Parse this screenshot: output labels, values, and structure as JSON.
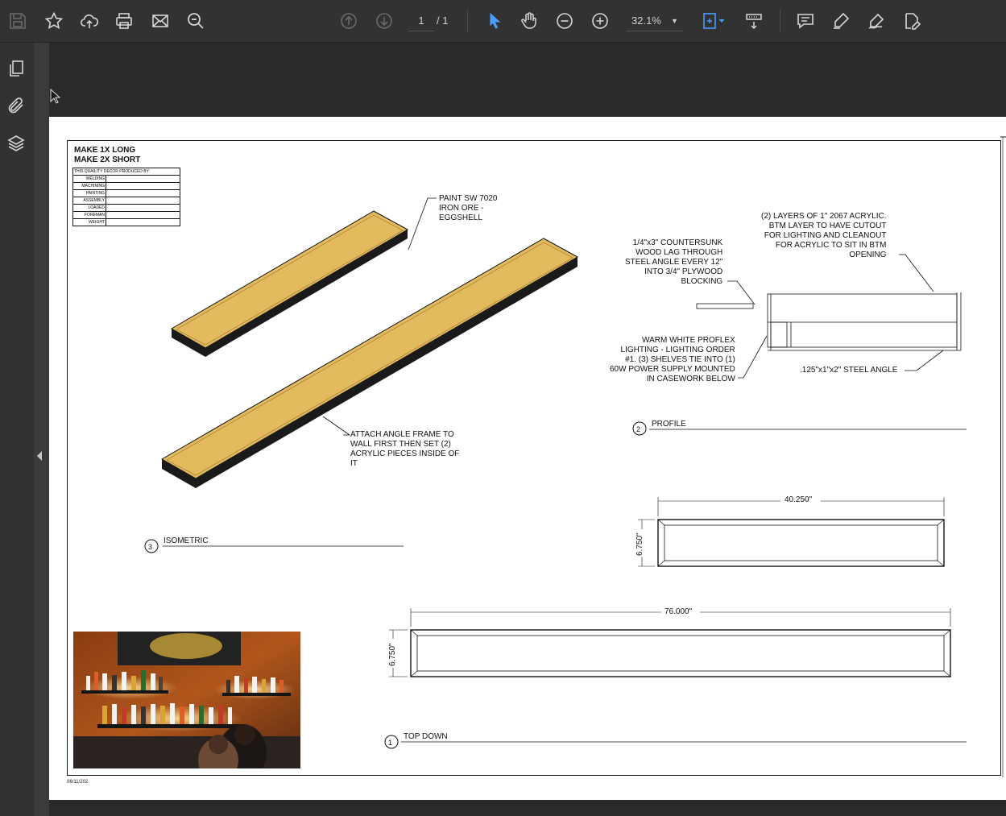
{
  "toolbar": {
    "page_current": "1",
    "page_total": "/ 1",
    "zoom": "32.1%",
    "icons": [
      "save-icon",
      "star-icon",
      "cloud-upload-icon",
      "print-icon",
      "mail-icon",
      "search-icon",
      "page-up-icon",
      "page-down-icon",
      "select-cursor-icon",
      "hand-icon",
      "zoom-out-icon",
      "zoom-in-icon",
      "fit-page-icon",
      "scroll-mode-icon",
      "comment-icon",
      "highlight-icon",
      "sign-icon",
      "edit-pdf-icon"
    ]
  },
  "rail": {
    "icons": [
      "pages-icon",
      "attachment-icon",
      "layers-icon"
    ]
  },
  "drawing": {
    "title_line1": "MAKE 1X LONG",
    "title_line2": "MAKE 2X SHORT",
    "quality_header": "THIS QUAILITY DECOR PRODUCED BY:",
    "quality_rows": [
      "WELDING",
      "MACHINING",
      "PAINTING",
      "ASSEMBLY",
      "LOADED",
      "FOREMAN",
      "WEIGHT"
    ],
    "note_paint": "PAINT SW 7020\nIRON ORE -\nEGGSHELL",
    "note_attach": "ATTACH ANGLE FRAME TO\nWALL FIRST THEN SET (2)\nACRYLIC PIECES INSIDE OF\nIT",
    "note_acrylic": "(2) LAYERS OF 1\" 2067 ACRYLIC.\nBTM LAYER TO HAVE CUTOUT\nFOR LIGHTING AND CLEANOUT\nFOR ACRYLIC TO SIT IN BTM\nOPENING",
    "note_lag": "1/4\"x3\" COUNTERSUNK\nWOOD LAG THROUGH\nSTEEL ANGLE EVERY 12\"\nINTO 3/4\" PLYWOOD\nBLOCKING",
    "note_light": "WARM WHITE PROFLEX\nLIGHTING - LIGHTING ORDER\n#1. (3) SHELVES TIE INTO (1)\n60W POWER SUPPLY MOUNTED\nIN CASEWORK BELOW",
    "note_angle": ".125\"x1\"x2\" STEEL ANGLE",
    "view2_num": "2",
    "view2_label": "PROFILE",
    "view3_num": "3",
    "view3_label": "ISOMETRIC",
    "view1_num": "1",
    "view1_label": "TOP DOWN",
    "dim_short_w": "40.250\"",
    "dim_short_h": "6.750\"",
    "dim_long_w": "76.000\"",
    "dim_long_h": "6.750\"",
    "date": "06/11/202"
  },
  "colors": {
    "shelf_top": "#e3bb5e",
    "shelf_side": "#1a1a1a",
    "ui_dark": "#323232",
    "accent_blue": "#4a9eff"
  }
}
